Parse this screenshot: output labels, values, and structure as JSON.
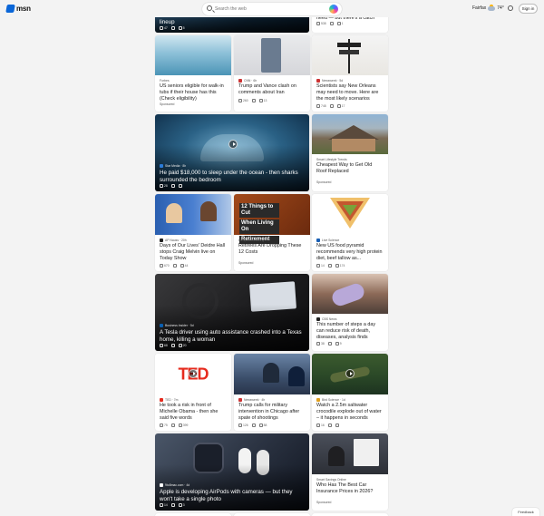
{
  "header": {
    "logo_text": "msn",
    "search_placeholder": "Search the web",
    "location": "Fairfax",
    "temperature": "74°",
    "signin_label": "Sign in"
  },
  "cards": [
    {
      "id": "c1",
      "headline": "lineup",
      "likes": "47",
      "comments": "5"
    },
    {
      "id": "c2",
      "headline": "need — but there's a catch",
      "likes": "538",
      "comments": "1"
    },
    {
      "id": "c3",
      "source": "Forbes",
      "headline": "US seniors eligible for walk-in tubs if their house has this (Check eligibility)",
      "sponsored": "Sponsored"
    },
    {
      "id": "c4",
      "source": "CNN · 6h",
      "headline": "Trump and Vance clash on comments about Iran",
      "likes": "260",
      "comments": "13"
    },
    {
      "id": "c5",
      "source": "Newsweek · 5d",
      "headline": "Scientists say New Orleans may need to move. Here are the most likely scenarios",
      "likes": "748",
      "comments": "17"
    },
    {
      "id": "c6",
      "source": "Star Media · 8h",
      "headline": "He paid $18,000 to sleep under the ocean - then sharks surrounded the bedroom",
      "likes": "28",
      "comments": ""
    },
    {
      "id": "c7",
      "source": "Smart Lifestyle Trends",
      "headline": "Cheapest Way to Get Old Roof Replaced",
      "sponsored": "Sponsored"
    },
    {
      "id": "c8",
      "source": "AP Nauss · 20h",
      "headline": "Days of Our Lives' Deidre Hall stops Craig Melvin live on Today Show",
      "likes": "670",
      "comments": "44"
    },
    {
      "id": "c9",
      "source": "thecycleresearcing",
      "headline": "Retirees Are Dropping These 12 Costs",
      "sponsored": "Sponsored",
      "image_text_1": "12 Things to Cut",
      "image_text_2": "When Living On",
      "image_text_3": "Retirement"
    },
    {
      "id": "c10",
      "source": "Live Science",
      "headline": "New US food pyramid recommends very high protein diet, beef tallow as...",
      "likes": "14",
      "comments": "174"
    },
    {
      "id": "c11",
      "source": "Business Insider · 5d",
      "headline": "A Tesla driver using auto assistance crashed into a Texas home, killing a woman",
      "likes": "68",
      "comments": "20"
    },
    {
      "id": "c12",
      "source": "CBS News",
      "headline": "This number of steps a day can reduce risk of death, diseases, analysis finds",
      "likes": "38",
      "comments": "9"
    },
    {
      "id": "c13",
      "source": "TED · 7m",
      "headline": "He took a risk in front of Michelle Obama - then she said five words",
      "likes": "75",
      "comments": "399",
      "image_text": "TED"
    },
    {
      "id": "c14",
      "source": "Newsweek · 4h",
      "headline": "Trump calls for military intervention in Chicago after spate of shootings",
      "likes": "126",
      "comments": "88"
    },
    {
      "id": "c15",
      "source": "Bird Science · 1d",
      "headline": "Watch a 2.5m saltwater crocodile explode out of water – it happens in seconds",
      "likes": "16",
      "comments": ""
    },
    {
      "id": "c16",
      "source": "9to5mac.com · 4d",
      "headline": "Apple is developing AirPods with cameras — but they won't take a single photo",
      "likes": "14",
      "comments": "3"
    },
    {
      "id": "c17",
      "source": "Smart Savings Online",
      "headline": "Who Has The Best Car Insurance Prices in 2026?",
      "sponsored": "Sponsored"
    }
  ],
  "feedback_label": "Feedback"
}
